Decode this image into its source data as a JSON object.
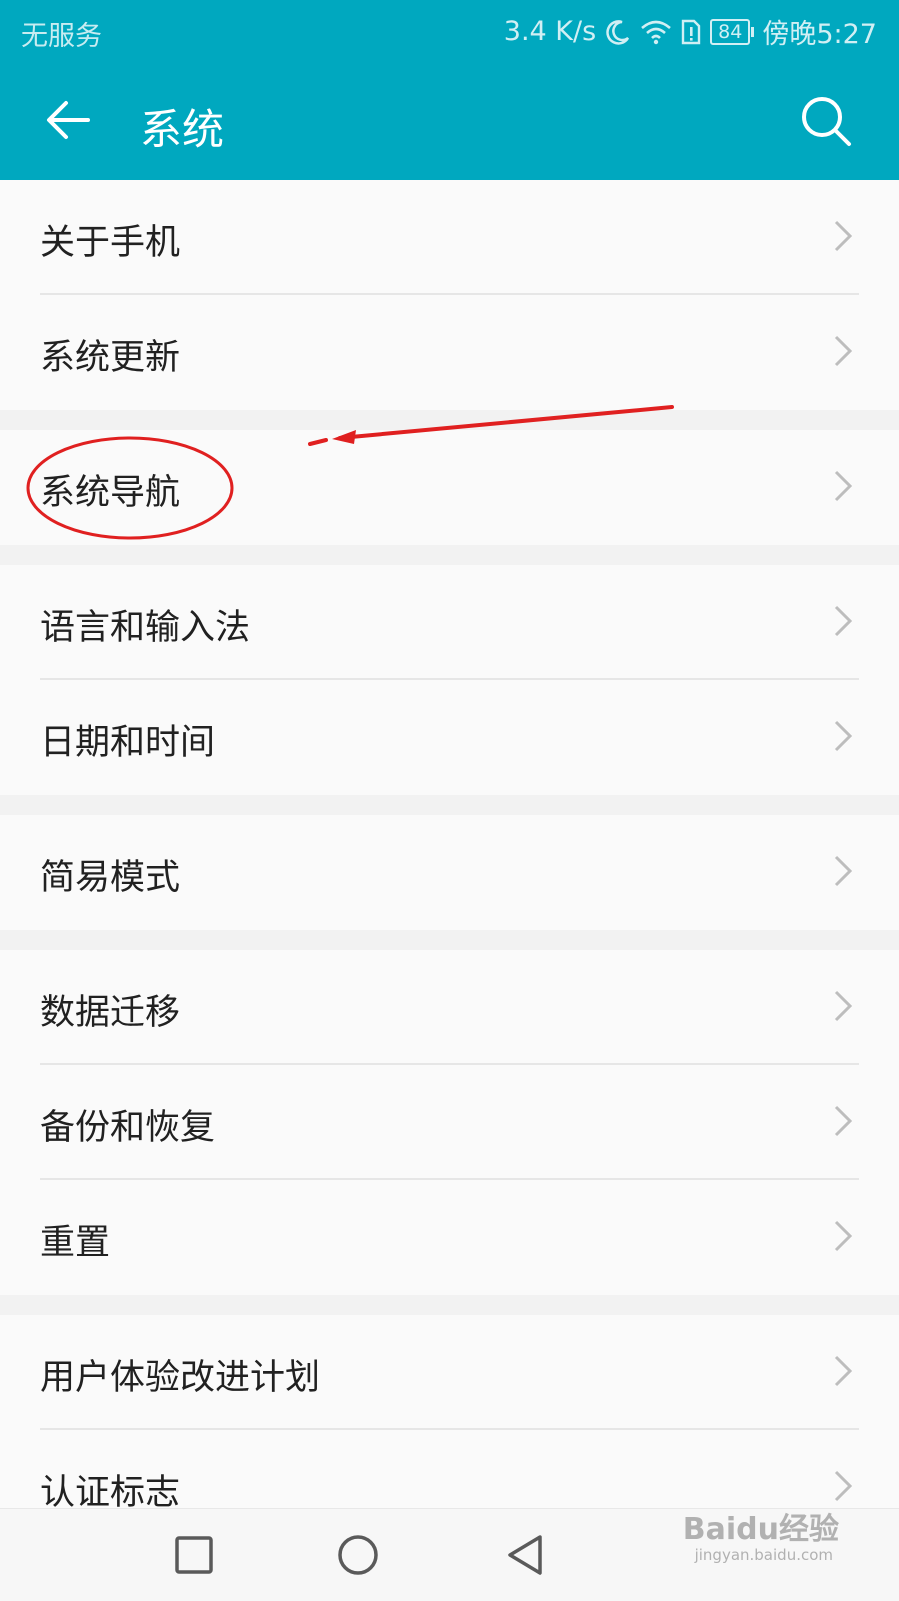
{
  "status_bar": {
    "carrier": "无服务",
    "net_speed": "3.4 K/s",
    "battery": "84",
    "time": "傍晚5:27"
  },
  "header": {
    "title": "系统"
  },
  "groups": [
    {
      "items": [
        "关于手机",
        "系统更新"
      ]
    },
    {
      "items": [
        "系统导航"
      ]
    },
    {
      "items": [
        "语言和输入法",
        "日期和时间"
      ]
    },
    {
      "items": [
        "简易模式"
      ]
    },
    {
      "items": [
        "数据迁移",
        "备份和恢复",
        "重置"
      ]
    },
    {
      "items": [
        "用户体验改进计划",
        "认证标志"
      ]
    }
  ],
  "watermark": {
    "brand": "Baidu经验",
    "url": "jingyan.baidu.com"
  },
  "colors": {
    "accent": "#00a8bf",
    "annotation": "#e02020"
  },
  "icons": [
    "back-arrow-icon",
    "search-icon",
    "chevron-right-icon",
    "recent-apps-square-icon",
    "home-circle-icon",
    "back-triangle-icon"
  ]
}
